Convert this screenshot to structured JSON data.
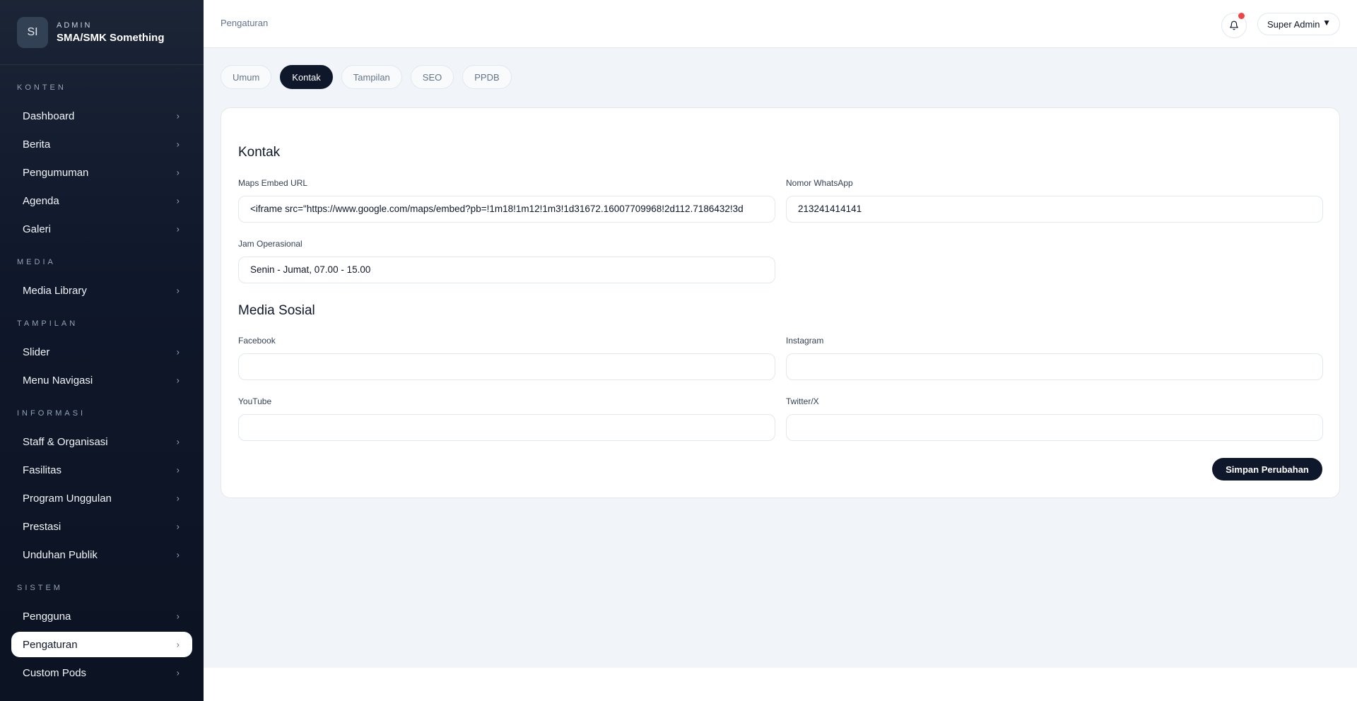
{
  "brand": {
    "logo_initials": "SI",
    "role": "ADMIN",
    "name": "SMA/SMK Something"
  },
  "sidebar": {
    "sections": [
      {
        "label": "KONTEN",
        "items": [
          "Dashboard",
          "Berita",
          "Pengumuman",
          "Agenda",
          "Galeri"
        ]
      },
      {
        "label": "MEDIA",
        "items": [
          "Media Library"
        ]
      },
      {
        "label": "TAMPILAN",
        "items": [
          "Slider",
          "Menu Navigasi"
        ]
      },
      {
        "label": "INFORMASI",
        "items": [
          "Staff & Organisasi",
          "Fasilitas",
          "Program Unggulan",
          "Prestasi",
          "Unduhan Publik"
        ]
      },
      {
        "label": "SISTEM",
        "items": [
          "Pengguna",
          "Pengaturan",
          "Custom Pods"
        ]
      }
    ],
    "active_item": "Pengaturan",
    "chevron_glyph": "›"
  },
  "header": {
    "breadcrumb": "Pengaturan",
    "notification_icon": "bell-icon",
    "user_label": "Super Admin",
    "user_caret": "▼"
  },
  "tabs": [
    "Umum",
    "Kontak",
    "Tampilan",
    "SEO",
    "PPDB"
  ],
  "active_tab": "Kontak",
  "form": {
    "kontak_title": "Kontak",
    "maps_label": "Maps Embed URL",
    "maps_value": "<iframe src=\"https://www.google.com/maps/embed?pb=!1m18!1m12!1m3!1d31672.16007709968!2d112.7186432!3d",
    "whatsapp_label": "Nomor WhatsApp",
    "whatsapp_value": "213241414141",
    "jam_label": "Jam Operasional",
    "jam_value": "Senin - Jumat, 07.00 - 15.00",
    "sosial_title": "Media Sosial",
    "facebook_label": "Facebook",
    "facebook_value": "",
    "instagram_label": "Instagram",
    "instagram_value": "",
    "youtube_label": "YouTube",
    "youtube_value": "",
    "twitter_label": "Twitter/X",
    "twitter_value": "",
    "save_label": "Simpan Perubahan"
  },
  "colors": {
    "sidebar_bg": "#0f172a",
    "accent": "#0f172a",
    "notification_dot": "#ef4444",
    "page_bg": "#f1f4f8"
  }
}
